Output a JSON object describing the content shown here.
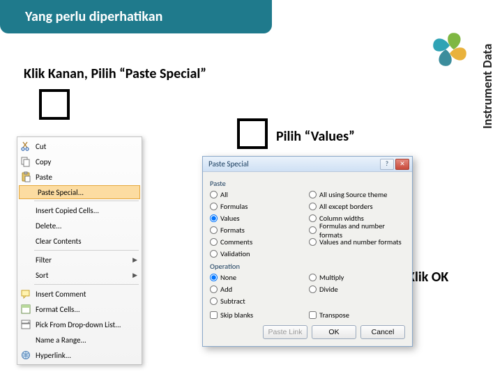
{
  "header": {
    "title": "Yang perlu diperhatikan"
  },
  "side_label": "Instrument Data",
  "instructions": {
    "step1": "Klik Kanan, Pilih “Paste Special”",
    "step2": "Pilih “Values”",
    "step3": "Klik OK"
  },
  "context_menu": {
    "cut": "Cut",
    "copy": "Copy",
    "paste": "Paste",
    "paste_special": "Paste Special...",
    "insert_copied": "Insert Copied Cells...",
    "delete": "Delete...",
    "clear_contents": "Clear Contents",
    "filter": "Filter",
    "sort": "Sort",
    "insert_comment": "Insert Comment",
    "format_cells": "Format Cells...",
    "pick_from_list": "Pick From Drop-down List...",
    "name_range": "Name a Range...",
    "hyperlink": "Hyperlink..."
  },
  "dialog": {
    "title": "Paste Special",
    "group_paste": "Paste",
    "group_operation": "Operation",
    "paste_options_left": [
      "All",
      "Formulas",
      "Values",
      "Formats",
      "Comments",
      "Validation"
    ],
    "paste_options_right": [
      "All using Source theme",
      "All except borders",
      "Column widths",
      "Formulas and number formats",
      "Values and number formats"
    ],
    "operation_left": [
      "None",
      "Add",
      "Subtract"
    ],
    "operation_right": [
      "Multiply",
      "Divide"
    ],
    "skip_blanks": "Skip blanks",
    "transpose": "Transpose",
    "paste_link": "Paste Link",
    "ok": "OK",
    "cancel": "Cancel",
    "selected_paste": "Values",
    "selected_operation": "None"
  },
  "logo_colors": {
    "c1": "#2fa3b5",
    "c2": "#7fb742",
    "c3": "#e9b23c",
    "c4": "#3c8d9c"
  }
}
